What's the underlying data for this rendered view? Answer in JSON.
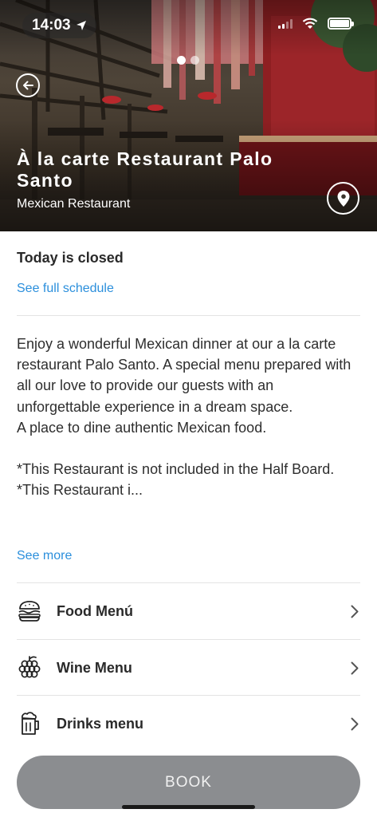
{
  "status_bar": {
    "time": "14:03"
  },
  "hero": {
    "title": "À la carte Restaurant Palo Santo",
    "subtitle": "Mexican Restaurant",
    "slide_count": 2,
    "active_slide": 1
  },
  "schedule": {
    "status": "Today is closed",
    "link_label": "See full schedule"
  },
  "description": {
    "text": "Enjoy a wonderful Mexican dinner at our a la carte restaurant Palo Santo. A special menu prepared with all our love to provide our guests with an unforgettable experience in a dream space.\nA place to dine authentic Mexican food.\n\n*This Restaurant is not included in the Half Board.\n*This Restaurant i...",
    "see_more_label": "See more"
  },
  "menus": [
    {
      "label": "Food Menú",
      "icon": "burger-icon"
    },
    {
      "label": "Wine Menu",
      "icon": "grapes-icon"
    },
    {
      "label": "Drinks menu",
      "icon": "beer-mug-icon"
    }
  ],
  "book_button": {
    "label": "BOOK"
  },
  "colors": {
    "link": "#2b8fdc",
    "book_button_bg": "#8b8d90",
    "divider": "#e3e3e3"
  }
}
